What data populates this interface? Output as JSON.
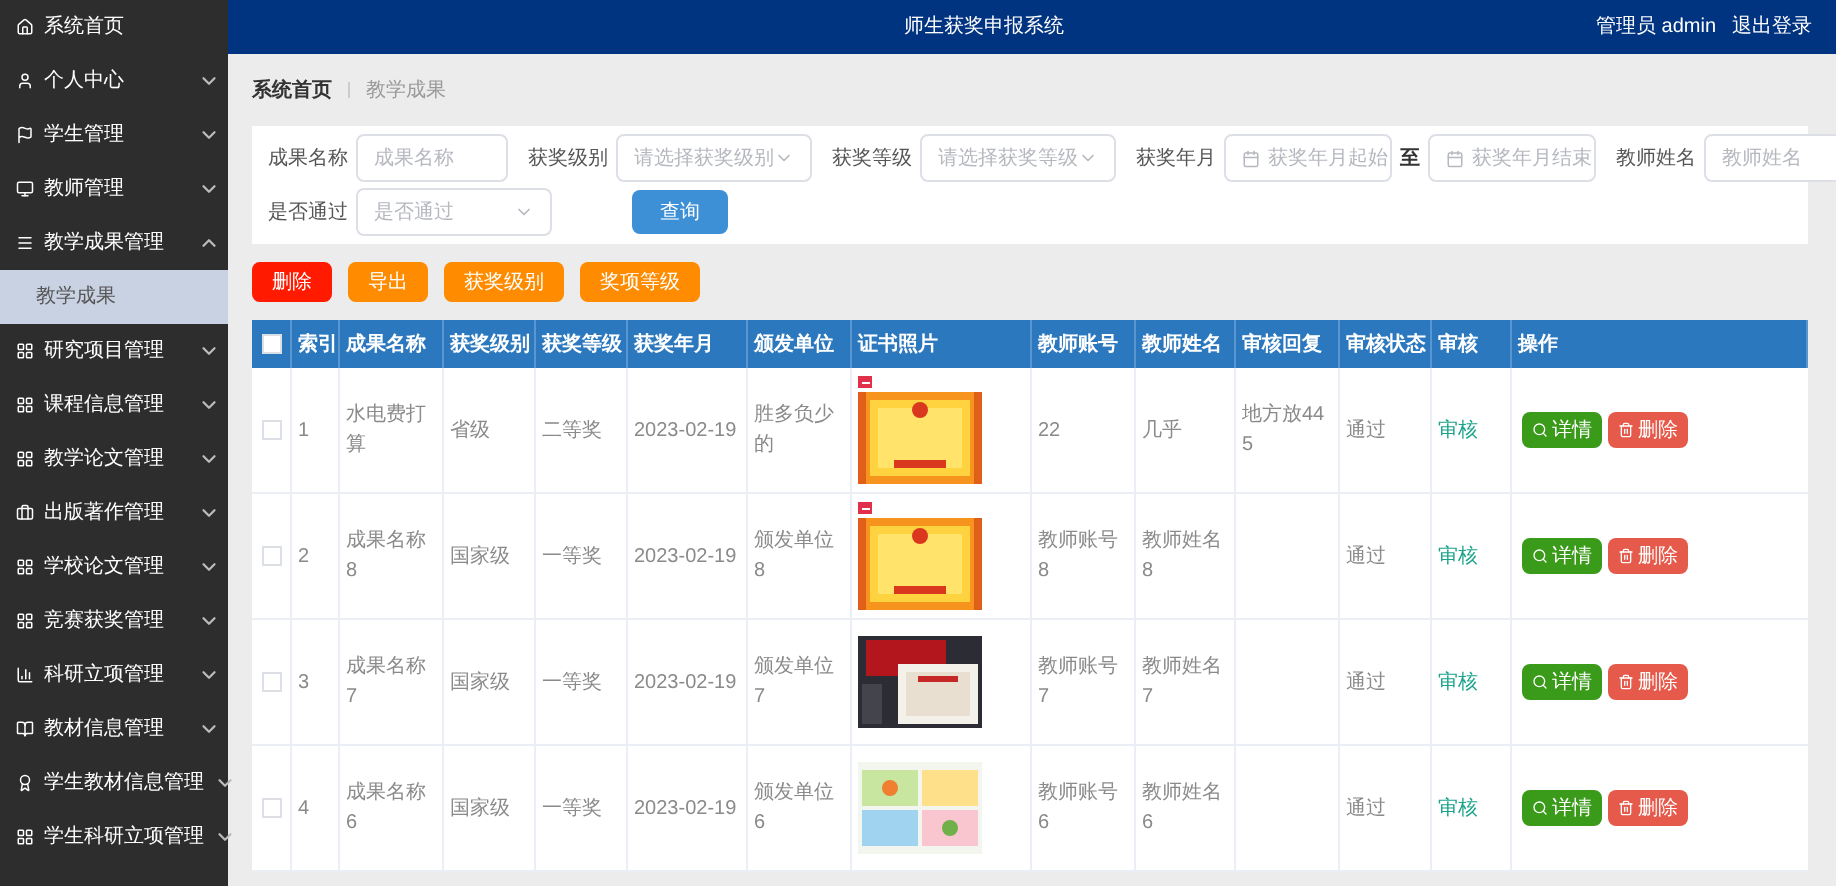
{
  "header": {
    "title": "师生获奖申报系统",
    "user": "管理员 admin",
    "logout": "退出登录"
  },
  "sidebar": {
    "items": [
      {
        "label": "系统首页",
        "kind": "home"
      },
      {
        "label": "个人中心",
        "kind": "user",
        "expanded": false
      },
      {
        "label": "学生管理",
        "kind": "flag",
        "expanded": false
      },
      {
        "label": "教师管理",
        "kind": "monitor",
        "expanded": false
      },
      {
        "label": "教学成果管理",
        "kind": "list",
        "expanded": true,
        "children": [
          {
            "label": "教学成果",
            "selected": true
          }
        ]
      },
      {
        "label": "研究项目管理",
        "kind": "grid",
        "expanded": false
      },
      {
        "label": "课程信息管理",
        "kind": "grid",
        "expanded": false
      },
      {
        "label": "教学论文管理",
        "kind": "grid",
        "expanded": false
      },
      {
        "label": "出版著作管理",
        "kind": "briefcase",
        "expanded": false
      },
      {
        "label": "学校论文管理",
        "kind": "grid",
        "expanded": false
      },
      {
        "label": "竞赛获奖管理",
        "kind": "grid",
        "expanded": false
      },
      {
        "label": "科研立项管理",
        "kind": "chart",
        "expanded": false
      },
      {
        "label": "教材信息管理",
        "kind": "book",
        "expanded": false
      },
      {
        "label": "学生教材信息管理",
        "kind": "badge",
        "expanded": false
      },
      {
        "label": "学生科研立项管理",
        "kind": "grid",
        "expanded": false
      }
    ]
  },
  "breadcrumb": [
    "系统首页",
    "教学成果"
  ],
  "filters": {
    "rows": [
      [
        {
          "kind": "text",
          "label": "成果名称",
          "placeholder": "成果名称"
        },
        {
          "kind": "select",
          "label": "获奖级别",
          "placeholder": "请选择获奖级别"
        },
        {
          "kind": "select",
          "label": "获奖等级",
          "placeholder": "请选择获奖等级"
        },
        {
          "kind": "date_range",
          "label": "获奖年月",
          "from_placeholder": "获奖年月起始",
          "separator": "至",
          "to_placeholder": "获奖年月结束"
        },
        {
          "kind": "text",
          "label": "教师姓名",
          "placeholder": "教师姓名"
        }
      ],
      [
        {
          "kind": "select",
          "label": "是否通过",
          "placeholder": "是否通过"
        }
      ]
    ],
    "search_button": "查询"
  },
  "actions": [
    {
      "label": "删除",
      "kind": "danger"
    },
    {
      "label": "导出",
      "kind": "warning"
    },
    {
      "label": "获奖级别",
      "kind": "warning"
    },
    {
      "label": "奖项等级",
      "kind": "warning"
    }
  ],
  "table": {
    "select_all_checked": false,
    "columns": [
      "索引",
      "成果名称",
      "获奖级别",
      "获奖等级",
      "获奖年月",
      "颁发单位",
      "证书照片",
      "教师账号",
      "教师姓名",
      "审核回复",
      "审核状态",
      "审核",
      "操作"
    ],
    "rows": [
      {
        "checked": false,
        "index": "1",
        "name": "水电费打算",
        "level": "省级",
        "grade": "二等奖",
        "date": "2023-02-19",
        "issuer": "胜多负少的",
        "photo": {
          "kind": "picture",
          "marked": true
        },
        "teacher_account": "22",
        "teacher_name": "几乎",
        "reply": "地方放445",
        "status": "通过",
        "audit": "审核",
        "detail": "详情",
        "delete": "删除"
      },
      {
        "checked": false,
        "index": "2",
        "name": "成果名称8",
        "level": "国家级",
        "grade": "一等奖",
        "date": "2023-02-19",
        "issuer": "颁发单位8",
        "photo": {
          "kind": "picture",
          "marked": true
        },
        "teacher_account": "教师账号8",
        "teacher_name": "教师姓名8",
        "status": "通过",
        "audit": "审核",
        "detail": "详情",
        "delete": "删除"
      },
      {
        "checked": false,
        "index": "3",
        "name": "成果名称7",
        "level": "国家级",
        "grade": "一等奖",
        "date": "2023-02-19",
        "issuer": "颁发单位7",
        "photo": {
          "kind": "picture",
          "marked": false
        },
        "teacher_account": "教师账号7",
        "teacher_name": "教师姓名7",
        "status": "通过",
        "audit": "审核",
        "detail": "详情",
        "delete": "删除"
      },
      {
        "checked": false,
        "index": "4",
        "name": "成果名称6",
        "level": "国家级",
        "grade": "一等奖",
        "date": "2023-02-19",
        "issuer": "颁发单位6",
        "photo": {
          "kind": "picture",
          "marked": false
        },
        "teacher_account": "教师账号6",
        "teacher_name": "教师姓名6",
        "status": "通过",
        "audit": "审核",
        "detail": "详情",
        "delete": "删除"
      }
    ]
  }
}
